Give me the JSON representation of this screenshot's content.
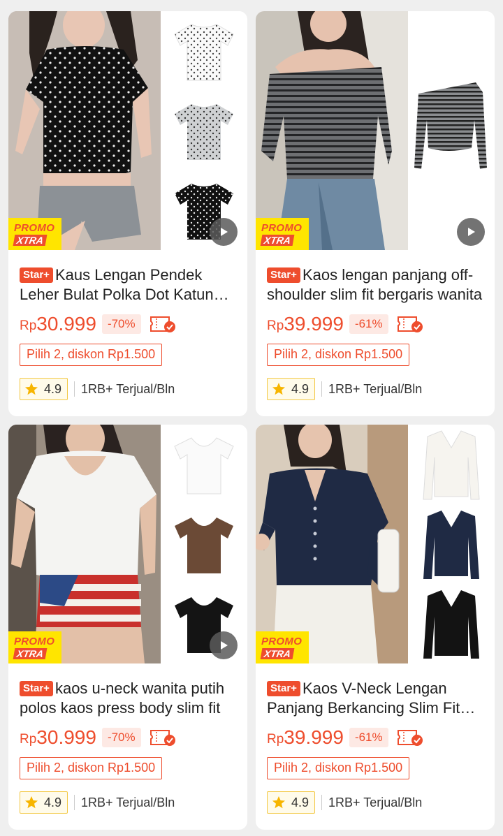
{
  "products": [
    {
      "badge": "Star+",
      "title": "Kaus Lengan Pendek Leher Bulat Polka Dot Katun Wanita",
      "currency": "Rp",
      "price": "30.999",
      "discount": "-70%",
      "offer": "Pilih 2, diskon Rp1.500",
      "rating": "4.9",
      "sold": "1RB+ Terjual/Bln",
      "promo_line1": "PROMO",
      "promo_line2": "XTRA"
    },
    {
      "badge": "Star+",
      "title": "Kaos lengan panjang off-shoulder slim fit bergaris wanita",
      "currency": "Rp",
      "price": "39.999",
      "discount": "-61%",
      "offer": "Pilih 2, diskon Rp1.500",
      "rating": "4.9",
      "sold": "1RB+ Terjual/Bln",
      "promo_line1": "PROMO",
      "promo_line2": "XTRA"
    },
    {
      "badge": "Star+",
      "title": "kaos u-neck wanita putih polos kaos press body slim fit",
      "currency": "Rp",
      "price": "30.999",
      "discount": "-70%",
      "offer": "Pilih 2, diskon Rp1.500",
      "rating": "4.9",
      "sold": "1RB+ Terjual/Bln",
      "promo_line1": "PROMO",
      "promo_line2": "XTRA"
    },
    {
      "badge": "Star+",
      "title": "Kaos V-Neck Lengan Panjang Berkancing Slim Fit Wanita",
      "currency": "Rp",
      "price": "39.999",
      "discount": "-61%",
      "offer": "Pilih 2, diskon Rp1.500",
      "rating": "4.9",
      "sold": "1RB+ Terjual/Bln",
      "promo_line1": "PROMO",
      "promo_line2": "XTRA"
    }
  ],
  "colors": {
    "accent": "#ee4d2d",
    "promo_yellow": "#ffe500",
    "rating_border": "#f3c843"
  },
  "icons": [
    "play-icon",
    "voucher-icon",
    "star-icon"
  ]
}
